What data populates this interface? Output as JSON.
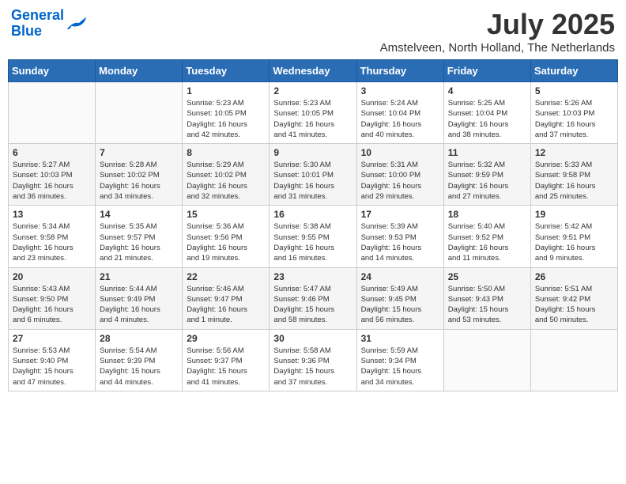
{
  "header": {
    "logo_line1": "General",
    "logo_line2": "Blue",
    "month_year": "July 2025",
    "location": "Amstelveen, North Holland, The Netherlands"
  },
  "weekdays": [
    "Sunday",
    "Monday",
    "Tuesday",
    "Wednesday",
    "Thursday",
    "Friday",
    "Saturday"
  ],
  "weeks": [
    [
      {
        "day": "",
        "info": ""
      },
      {
        "day": "",
        "info": ""
      },
      {
        "day": "1",
        "info": "Sunrise: 5:23 AM\nSunset: 10:05 PM\nDaylight: 16 hours\nand 42 minutes."
      },
      {
        "day": "2",
        "info": "Sunrise: 5:23 AM\nSunset: 10:05 PM\nDaylight: 16 hours\nand 41 minutes."
      },
      {
        "day": "3",
        "info": "Sunrise: 5:24 AM\nSunset: 10:04 PM\nDaylight: 16 hours\nand 40 minutes."
      },
      {
        "day": "4",
        "info": "Sunrise: 5:25 AM\nSunset: 10:04 PM\nDaylight: 16 hours\nand 38 minutes."
      },
      {
        "day": "5",
        "info": "Sunrise: 5:26 AM\nSunset: 10:03 PM\nDaylight: 16 hours\nand 37 minutes."
      }
    ],
    [
      {
        "day": "6",
        "info": "Sunrise: 5:27 AM\nSunset: 10:03 PM\nDaylight: 16 hours\nand 36 minutes."
      },
      {
        "day": "7",
        "info": "Sunrise: 5:28 AM\nSunset: 10:02 PM\nDaylight: 16 hours\nand 34 minutes."
      },
      {
        "day": "8",
        "info": "Sunrise: 5:29 AM\nSunset: 10:02 PM\nDaylight: 16 hours\nand 32 minutes."
      },
      {
        "day": "9",
        "info": "Sunrise: 5:30 AM\nSunset: 10:01 PM\nDaylight: 16 hours\nand 31 minutes."
      },
      {
        "day": "10",
        "info": "Sunrise: 5:31 AM\nSunset: 10:00 PM\nDaylight: 16 hours\nand 29 minutes."
      },
      {
        "day": "11",
        "info": "Sunrise: 5:32 AM\nSunset: 9:59 PM\nDaylight: 16 hours\nand 27 minutes."
      },
      {
        "day": "12",
        "info": "Sunrise: 5:33 AM\nSunset: 9:58 PM\nDaylight: 16 hours\nand 25 minutes."
      }
    ],
    [
      {
        "day": "13",
        "info": "Sunrise: 5:34 AM\nSunset: 9:58 PM\nDaylight: 16 hours\nand 23 minutes."
      },
      {
        "day": "14",
        "info": "Sunrise: 5:35 AM\nSunset: 9:57 PM\nDaylight: 16 hours\nand 21 minutes."
      },
      {
        "day": "15",
        "info": "Sunrise: 5:36 AM\nSunset: 9:56 PM\nDaylight: 16 hours\nand 19 minutes."
      },
      {
        "day": "16",
        "info": "Sunrise: 5:38 AM\nSunset: 9:55 PM\nDaylight: 16 hours\nand 16 minutes."
      },
      {
        "day": "17",
        "info": "Sunrise: 5:39 AM\nSunset: 9:53 PM\nDaylight: 16 hours\nand 14 minutes."
      },
      {
        "day": "18",
        "info": "Sunrise: 5:40 AM\nSunset: 9:52 PM\nDaylight: 16 hours\nand 11 minutes."
      },
      {
        "day": "19",
        "info": "Sunrise: 5:42 AM\nSunset: 9:51 PM\nDaylight: 16 hours\nand 9 minutes."
      }
    ],
    [
      {
        "day": "20",
        "info": "Sunrise: 5:43 AM\nSunset: 9:50 PM\nDaylight: 16 hours\nand 6 minutes."
      },
      {
        "day": "21",
        "info": "Sunrise: 5:44 AM\nSunset: 9:49 PM\nDaylight: 16 hours\nand 4 minutes."
      },
      {
        "day": "22",
        "info": "Sunrise: 5:46 AM\nSunset: 9:47 PM\nDaylight: 16 hours\nand 1 minute."
      },
      {
        "day": "23",
        "info": "Sunrise: 5:47 AM\nSunset: 9:46 PM\nDaylight: 15 hours\nand 58 minutes."
      },
      {
        "day": "24",
        "info": "Sunrise: 5:49 AM\nSunset: 9:45 PM\nDaylight: 15 hours\nand 56 minutes."
      },
      {
        "day": "25",
        "info": "Sunrise: 5:50 AM\nSunset: 9:43 PM\nDaylight: 15 hours\nand 53 minutes."
      },
      {
        "day": "26",
        "info": "Sunrise: 5:51 AM\nSunset: 9:42 PM\nDaylight: 15 hours\nand 50 minutes."
      }
    ],
    [
      {
        "day": "27",
        "info": "Sunrise: 5:53 AM\nSunset: 9:40 PM\nDaylight: 15 hours\nand 47 minutes."
      },
      {
        "day": "28",
        "info": "Sunrise: 5:54 AM\nSunset: 9:39 PM\nDaylight: 15 hours\nand 44 minutes."
      },
      {
        "day": "29",
        "info": "Sunrise: 5:56 AM\nSunset: 9:37 PM\nDaylight: 15 hours\nand 41 minutes."
      },
      {
        "day": "30",
        "info": "Sunrise: 5:58 AM\nSunset: 9:36 PM\nDaylight: 15 hours\nand 37 minutes."
      },
      {
        "day": "31",
        "info": "Sunrise: 5:59 AM\nSunset: 9:34 PM\nDaylight: 15 hours\nand 34 minutes."
      },
      {
        "day": "",
        "info": ""
      },
      {
        "day": "",
        "info": ""
      }
    ]
  ]
}
